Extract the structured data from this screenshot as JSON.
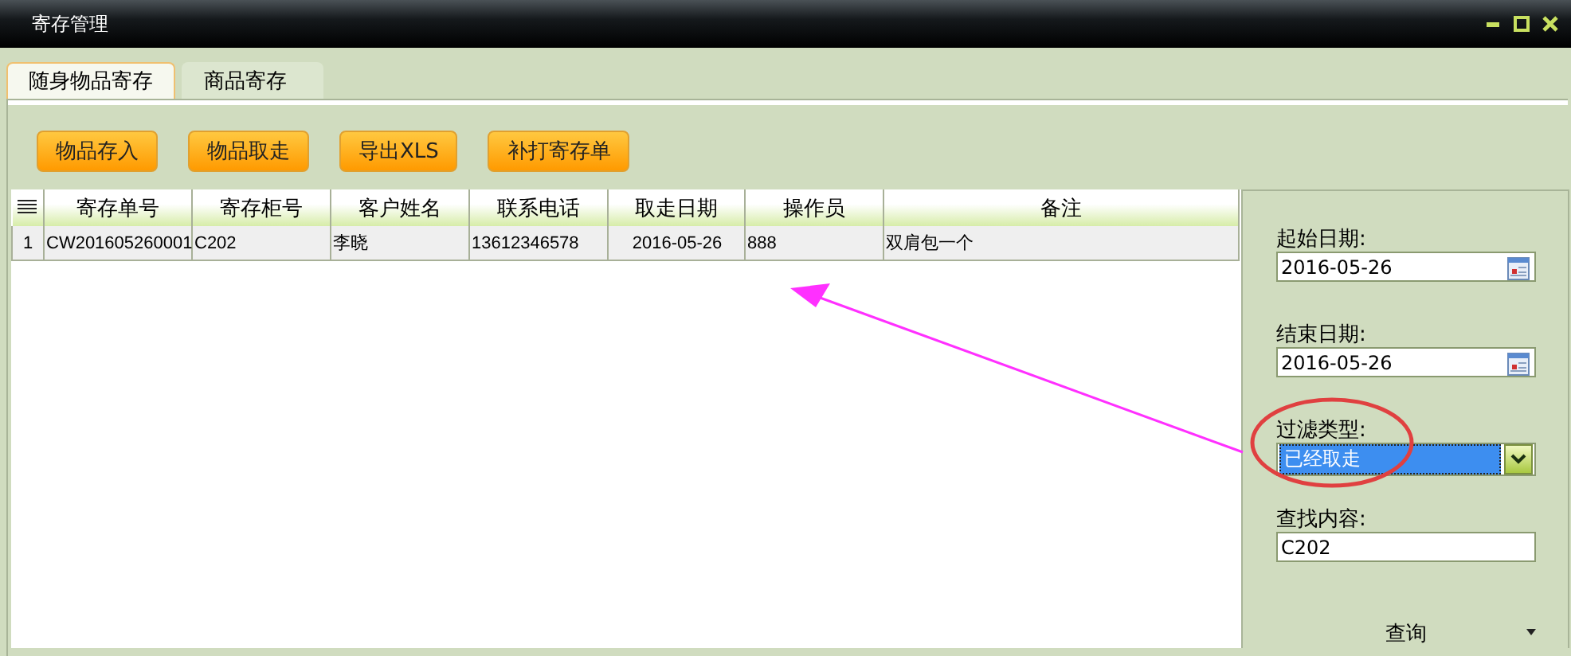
{
  "window": {
    "title": "寄存管理"
  },
  "tabs": [
    {
      "label": "随身物品寄存",
      "selected": true
    },
    {
      "label": "商品寄存",
      "selected": false
    }
  ],
  "toolbar": [
    "物品存入",
    "物品取走",
    "导出XLS",
    "补打寄存单"
  ],
  "table": {
    "columns": [
      "寄存单号",
      "寄存柜号",
      "客户姓名",
      "联系电话",
      "取走日期",
      "操作员",
      "备注"
    ],
    "rows": [
      {
        "number": "1",
        "cells": [
          "CW201605260001",
          "C202",
          "李晓",
          "13612346578",
          "2016-05-26",
          "888",
          "双肩包一个"
        ],
        "selected": true
      }
    ]
  },
  "filter": {
    "fields": [
      {
        "kind": "date",
        "label": "起始日期:",
        "value": "2016-05-26"
      },
      {
        "kind": "date",
        "label": "结束日期:",
        "value": "2016-05-26"
      },
      {
        "kind": "select",
        "label": "过滤类型:",
        "value": "已经取走"
      },
      {
        "kind": "text",
        "label": "查找内容:",
        "value": "C202"
      }
    ],
    "button": "查询"
  }
}
